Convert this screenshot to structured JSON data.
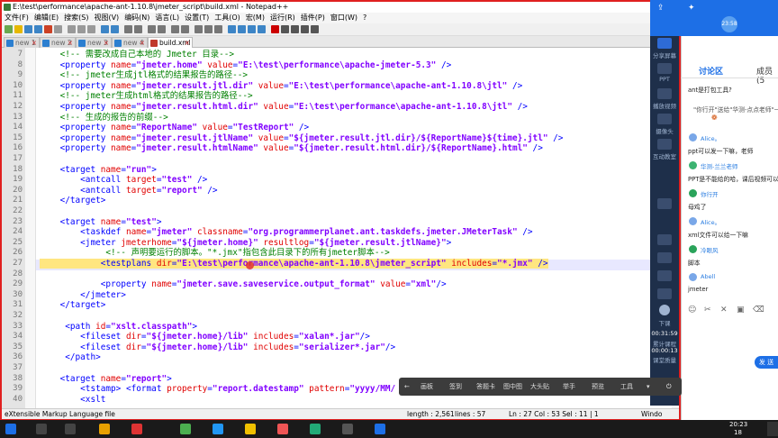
{
  "window": {
    "title": "E:\\test\\performance\\apache-ant-1.10.8\\jmeter_script\\build.xml - Notepad++"
  },
  "menu": [
    "文件(F)",
    "编辑(E)",
    "搜索(S)",
    "视图(V)",
    "编码(N)",
    "语言(L)",
    "设置(T)",
    "工具(O)",
    "宏(M)",
    "运行(R)",
    "插件(P)",
    "窗口(W)",
    "?"
  ],
  "menu_close": "X",
  "tabs": [
    {
      "label": "new 1"
    },
    {
      "label": "new 2"
    },
    {
      "label": "new 3"
    },
    {
      "label": "new 4"
    },
    {
      "label": "build.xml"
    }
  ],
  "editor": {
    "line_numbers": [
      "7",
      "8",
      "9",
      "10",
      "11",
      "12",
      "13",
      "14",
      "15",
      "16",
      "17",
      "18",
      "19",
      "20",
      "21",
      "22",
      "23",
      "24",
      "25",
      "26",
      "27",
      "28",
      "29",
      "30",
      "31",
      "32",
      "33",
      "34",
      "35",
      "36",
      "37",
      "38",
      "39",
      "40"
    ],
    "lines": [
      [
        {
          "c": "cm",
          "t": "    <!-- 需要改成自己本地的 Jmeter 目录-->"
        }
      ],
      [
        {
          "c": "tg",
          "t": "    <property "
        },
        {
          "c": "at",
          "t": "name"
        },
        {
          "c": "tg",
          "t": "="
        },
        {
          "c": "vl",
          "t": "\"jmeter.home\""
        },
        {
          "c": "at",
          "t": " value"
        },
        {
          "c": "tg",
          "t": "="
        },
        {
          "c": "vl",
          "t": "\"E:\\test\\performance\\apache-jmeter-5.3\""
        },
        {
          "c": "tg",
          "t": " />"
        }
      ],
      [
        {
          "c": "cm",
          "t": "    <!-- jmeter生成jtl格式的结果报告的路径-->"
        }
      ],
      [
        {
          "c": "tg",
          "t": "    <property "
        },
        {
          "c": "at",
          "t": "name"
        },
        {
          "c": "tg",
          "t": "="
        },
        {
          "c": "vl",
          "t": "\"jmeter.result.jtl.dir\""
        },
        {
          "c": "at",
          "t": " value"
        },
        {
          "c": "tg",
          "t": "="
        },
        {
          "c": "vl",
          "t": "\"E:\\test\\performance\\apache-ant-1.10.8\\jtl\""
        },
        {
          "c": "tg",
          "t": " />"
        }
      ],
      [
        {
          "c": "cm",
          "t": "    <!-- jmeter生成html格式的结果报告的路径-->"
        }
      ],
      [
        {
          "c": "tg",
          "t": "    <property "
        },
        {
          "c": "at",
          "t": "name"
        },
        {
          "c": "tg",
          "t": "="
        },
        {
          "c": "vl",
          "t": "\"jmeter.result.html.dir\""
        },
        {
          "c": "at",
          "t": " value"
        },
        {
          "c": "tg",
          "t": "="
        },
        {
          "c": "vl",
          "t": "\"E:\\test\\performance\\apache-ant-1.10.8\\jtl\""
        },
        {
          "c": "tg",
          "t": " />"
        }
      ],
      [
        {
          "c": "cm",
          "t": "    <!-- 生成的报告的前缀-->"
        }
      ],
      [
        {
          "c": "tg",
          "t": "    <property "
        },
        {
          "c": "at",
          "t": "name"
        },
        {
          "c": "tg",
          "t": "="
        },
        {
          "c": "vl",
          "t": "\"ReportName\""
        },
        {
          "c": "at",
          "t": " value"
        },
        {
          "c": "tg",
          "t": "="
        },
        {
          "c": "vl",
          "t": "\"TestReport\""
        },
        {
          "c": "tg",
          "t": " />"
        }
      ],
      [
        {
          "c": "tg",
          "t": "    <property "
        },
        {
          "c": "at",
          "t": "name"
        },
        {
          "c": "tg",
          "t": "="
        },
        {
          "c": "vl",
          "t": "\"jmeter.result.jtlName\""
        },
        {
          "c": "at",
          "t": " value"
        },
        {
          "c": "tg",
          "t": "="
        },
        {
          "c": "vl",
          "t": "\"${jmeter.result.jtl.dir}/${ReportName}${time}.jtl\""
        },
        {
          "c": "tg",
          "t": " />"
        }
      ],
      [
        {
          "c": "tg",
          "t": "    <property "
        },
        {
          "c": "at",
          "t": "name"
        },
        {
          "c": "tg",
          "t": "="
        },
        {
          "c": "vl",
          "t": "\"jmeter.result.htmlName\""
        },
        {
          "c": "at",
          "t": " value"
        },
        {
          "c": "tg",
          "t": "="
        },
        {
          "c": "vl",
          "t": "\"${jmeter.result.html.dir}/${ReportName}.html\""
        },
        {
          "c": "tg",
          "t": " />"
        }
      ],
      [
        {
          "c": "tg",
          "t": ""
        }
      ],
      [
        {
          "c": "tg",
          "t": "    <target "
        },
        {
          "c": "at",
          "t": "name"
        },
        {
          "c": "tg",
          "t": "="
        },
        {
          "c": "vl",
          "t": "\"run\""
        },
        {
          "c": "tg",
          "t": ">"
        }
      ],
      [
        {
          "c": "tg",
          "t": "        <antcall "
        },
        {
          "c": "at",
          "t": "target"
        },
        {
          "c": "tg",
          "t": "="
        },
        {
          "c": "vl",
          "t": "\"test\""
        },
        {
          "c": "tg",
          "t": " />"
        }
      ],
      [
        {
          "c": "tg",
          "t": "        <antcall "
        },
        {
          "c": "at",
          "t": "target"
        },
        {
          "c": "tg",
          "t": "="
        },
        {
          "c": "vl",
          "t": "\"report\""
        },
        {
          "c": "tg",
          "t": " />"
        }
      ],
      [
        {
          "c": "tg",
          "t": "    </target>"
        }
      ],
      [
        {
          "c": "tg",
          "t": ""
        }
      ],
      [
        {
          "c": "tg",
          "t": "    <target "
        },
        {
          "c": "at",
          "t": "name"
        },
        {
          "c": "tg",
          "t": "="
        },
        {
          "c": "vl",
          "t": "\"test\""
        },
        {
          "c": "tg",
          "t": ">"
        }
      ],
      [
        {
          "c": "tg",
          "t": "        <taskdef "
        },
        {
          "c": "at",
          "t": "name"
        },
        {
          "c": "tg",
          "t": "="
        },
        {
          "c": "vl",
          "t": "\"jmeter\""
        },
        {
          "c": "at",
          "t": " classname"
        },
        {
          "c": "tg",
          "t": "="
        },
        {
          "c": "vl",
          "t": "\"org.programmerplanet.ant.taskdefs.jmeter.JMeterTask\""
        },
        {
          "c": "tg",
          "t": " />"
        }
      ],
      [
        {
          "c": "tg",
          "t": "        <jmeter "
        },
        {
          "c": "at",
          "t": "jmeterhome"
        },
        {
          "c": "tg",
          "t": "="
        },
        {
          "c": "vl",
          "t": "\"${jmeter.home}\""
        },
        {
          "c": "at",
          "t": " resultlog"
        },
        {
          "c": "tg",
          "t": "="
        },
        {
          "c": "vl",
          "t": "\"${jmeter.result.jtlName}\""
        },
        {
          "c": "tg",
          "t": ">"
        }
      ],
      [
        {
          "c": "cm",
          "t": "             <!-- 声明要运行的脚本。\"*.jmx\"指包含此目录下的所有jmeter脚本-->"
        }
      ],
      [
        {
          "c": "tg hl",
          "t": "            <testplans "
        },
        {
          "c": "at hl",
          "t": "dir"
        },
        {
          "c": "tg hl",
          "t": "="
        },
        {
          "c": "vl hl",
          "t": "\"E:\\test\\performance\\apache-ant-1.10.8\\jmeter_script\""
        },
        {
          "c": "at hl",
          "t": " includes"
        },
        {
          "c": "tg hl",
          "t": "="
        },
        {
          "c": "vl hl",
          "t": "\"*.jmx\""
        },
        {
          "c": "tg hl",
          "t": " />"
        }
      ],
      [
        {
          "c": "tg",
          "t": ""
        }
      ],
      [
        {
          "c": "tg",
          "t": "            <property "
        },
        {
          "c": "at",
          "t": "name"
        },
        {
          "c": "tg",
          "t": "="
        },
        {
          "c": "vl",
          "t": "\"jmeter.save.saveservice.output_format\""
        },
        {
          "c": "at",
          "t": " value"
        },
        {
          "c": "tg",
          "t": "="
        },
        {
          "c": "vl",
          "t": "\"xml\""
        },
        {
          "c": "tg",
          "t": "/>"
        }
      ],
      [
        {
          "c": "tg",
          "t": "        </jmeter>"
        }
      ],
      [
        {
          "c": "tg",
          "t": "    </target>"
        }
      ],
      [
        {
          "c": "tg",
          "t": ""
        }
      ],
      [
        {
          "c": "tg",
          "t": "     <path "
        },
        {
          "c": "at",
          "t": "id"
        },
        {
          "c": "tg",
          "t": "="
        },
        {
          "c": "vl",
          "t": "\"xslt.classpath\""
        },
        {
          "c": "tg",
          "t": ">"
        }
      ],
      [
        {
          "c": "tg",
          "t": "        <fileset "
        },
        {
          "c": "at",
          "t": "dir"
        },
        {
          "c": "tg",
          "t": "="
        },
        {
          "c": "vl",
          "t": "\"${jmeter.home}/lib\""
        },
        {
          "c": "at",
          "t": " includes"
        },
        {
          "c": "tg",
          "t": "="
        },
        {
          "c": "vl",
          "t": "\"xalan*.jar\""
        },
        {
          "c": "tg",
          "t": "/>"
        }
      ],
      [
        {
          "c": "tg",
          "t": "        <fileset "
        },
        {
          "c": "at",
          "t": "dir"
        },
        {
          "c": "tg",
          "t": "="
        },
        {
          "c": "vl",
          "t": "\"${jmeter.home}/lib\""
        },
        {
          "c": "at",
          "t": " includes"
        },
        {
          "c": "tg",
          "t": "="
        },
        {
          "c": "vl",
          "t": "\"serializer*.jar\""
        },
        {
          "c": "tg",
          "t": "/>"
        }
      ],
      [
        {
          "c": "tg",
          "t": "     </path>"
        }
      ],
      [
        {
          "c": "tg",
          "t": ""
        }
      ],
      [
        {
          "c": "tg",
          "t": "    <target "
        },
        {
          "c": "at",
          "t": "name"
        },
        {
          "c": "tg",
          "t": "="
        },
        {
          "c": "vl",
          "t": "\"report\""
        },
        {
          "c": "tg",
          "t": ">"
        }
      ],
      [
        {
          "c": "tg",
          "t": "        <tstamp> <format "
        },
        {
          "c": "at",
          "t": "property"
        },
        {
          "c": "tg",
          "t": "="
        },
        {
          "c": "vl",
          "t": "\"report.datestamp\""
        },
        {
          "c": "at",
          "t": " pattern"
        },
        {
          "c": "tg",
          "t": "="
        },
        {
          "c": "vl",
          "t": "\"yyyy/MM/"
        }
      ],
      [
        {
          "c": "tg",
          "t": "        <xslt"
        }
      ]
    ]
  },
  "statusbar": {
    "filetype": "eXtensible Markup Language file",
    "length": "length : 2,561",
    "lines": "lines : 57",
    "pos": "Ln : 27    Col : 53    Sel : 11 | 1",
    "eol": "Windo"
  },
  "sidebar": {
    "items": [
      "分享屏幕",
      "PPT",
      "播放视频",
      "摄像头",
      "互动教室"
    ],
    "bottom": [
      "下课",
      "00:31:59",
      "累计课程",
      "00:00:13",
      "课堂质量"
    ]
  },
  "panel": {
    "clock": "23:58",
    "tabs": [
      "讨论区",
      "成员(5"
    ],
    "messages": [
      {
        "user": "",
        "text": "ant是打包工具?"
      },
      {
        "user": "",
        "text": "\"你行开\"送给\"华测-点点老师\"一"
      },
      {
        "user": "Alice。",
        "text": "ppt可以发一下嘛，老师"
      },
      {
        "user": "华测-兰兰老师",
        "text": "PPT是不能给的哈，课后视频可以"
      },
      {
        "user": "你行开",
        "text": "母鸡了"
      },
      {
        "user": "Alice。",
        "text": "xml文件可以给一下嘛"
      },
      {
        "user": "冷眼风",
        "text": "脚本"
      },
      {
        "user": "Abell",
        "text": "jmeter"
      }
    ],
    "send": "发 送"
  },
  "mediabar": [
    "画板",
    "签到",
    "答题卡",
    "图中图",
    "大头贴",
    "举手",
    "预览",
    "工具"
  ],
  "tray": {
    "time": "20:23",
    "date": "18"
  },
  "colors": {
    "accent": "#1d6fe6",
    "keyword": "#0000ff",
    "attr": "#e00000",
    "value": "#8000ff",
    "comment": "#008000"
  }
}
